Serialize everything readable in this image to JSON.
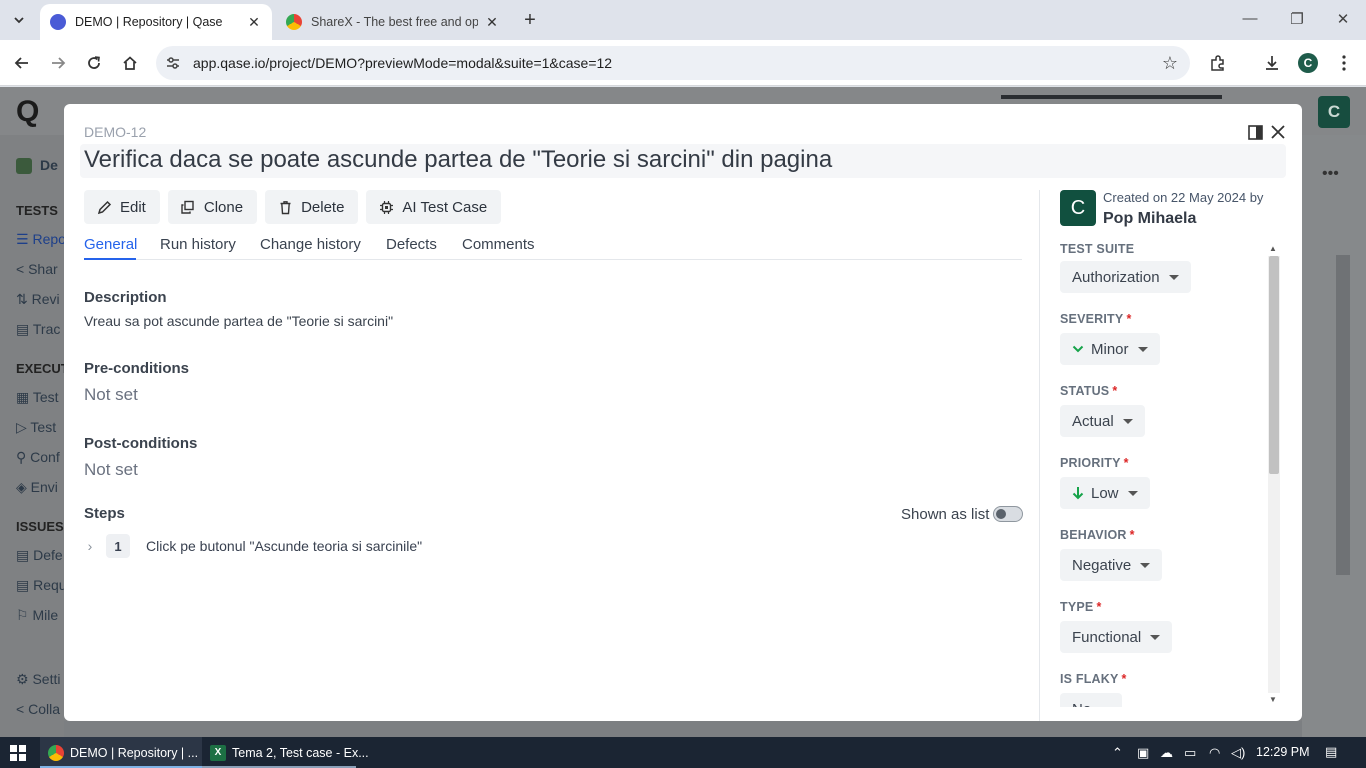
{
  "browser": {
    "tabs": [
      {
        "title": "DEMO | Repository | Qase",
        "active": true
      },
      {
        "title": "ShareX - The best free and ope",
        "active": false
      }
    ],
    "url": "app.qase.io/project/DEMO?previewMode=modal&suite=1&case=12",
    "profile_initial": "C"
  },
  "background_app": {
    "logo": "Q",
    "avatar_initial": "C",
    "sidebar": [
      {
        "text": "De",
        "kind": "project"
      },
      {
        "text": "TESTS",
        "kind": "heading"
      },
      {
        "text": "Repo",
        "kind": "item"
      },
      {
        "text": "Shar",
        "kind": "item"
      },
      {
        "text": "Revi",
        "kind": "item"
      },
      {
        "text": "Trac",
        "kind": "item"
      },
      {
        "text": "EXECUTI",
        "kind": "heading"
      },
      {
        "text": "Test",
        "kind": "item"
      },
      {
        "text": "Test",
        "kind": "item"
      },
      {
        "text": "Conf",
        "kind": "item"
      },
      {
        "text": "Envi",
        "kind": "item"
      },
      {
        "text": "ISSUES",
        "kind": "heading"
      },
      {
        "text": "Defe",
        "kind": "item"
      },
      {
        "text": "Requ",
        "kind": "item"
      },
      {
        "text": "Mile",
        "kind": "item"
      },
      {
        "text": "Setti",
        "kind": "item"
      },
      {
        "text": "Colla",
        "kind": "item"
      }
    ]
  },
  "modal": {
    "case_id": "DEMO-12",
    "title": "Verifica daca se poate ascunde partea de \"Teorie si sarcini\" din pagina",
    "actions": [
      {
        "label": "Edit",
        "icon": "pencil-icon"
      },
      {
        "label": "Clone",
        "icon": "copy-icon"
      },
      {
        "label": "Delete",
        "icon": "trash-icon"
      },
      {
        "label": "AI Test Case",
        "icon": "chip-icon"
      }
    ],
    "tabs": [
      "General",
      "Run history",
      "Change history",
      "Defects",
      "Comments"
    ],
    "active_tab": "General",
    "description_label": "Description",
    "description": "Vreau sa pot ascunde partea de \"Teorie si sarcini\"",
    "preconditions_label": "Pre-conditions",
    "preconditions": "Not set",
    "postconditions_label": "Post-conditions",
    "postconditions": "Not set",
    "steps_label": "Steps",
    "shown_as_list_label": "Shown as list",
    "shown_as_list": false,
    "steps": [
      {
        "number": "1",
        "text": "Click pe butonul \"Ascunde teoria si sarcinile\""
      }
    ]
  },
  "sidepanel": {
    "avatar_initial": "C",
    "created_on": "Created on 22 May 2024 by",
    "author": "Pop Mihaela",
    "properties": [
      {
        "label": "TEST SUITE",
        "required": false,
        "value": "Authorization",
        "icon": null
      },
      {
        "label": "SEVERITY",
        "required": true,
        "value": "Minor",
        "icon": "chevron-down-green-icon"
      },
      {
        "label": "STATUS",
        "required": true,
        "value": "Actual",
        "icon": null
      },
      {
        "label": "PRIORITY",
        "required": true,
        "value": "Low",
        "icon": "arrow-down-green-icon"
      },
      {
        "label": "BEHAVIOR",
        "required": true,
        "value": "Negative",
        "icon": null
      },
      {
        "label": "TYPE",
        "required": true,
        "value": "Functional",
        "icon": null
      },
      {
        "label": "IS FLAKY",
        "required": true,
        "value": "No",
        "icon": null
      }
    ],
    "required_marker": "*"
  },
  "taskbar": {
    "items": [
      {
        "label": "DEMO | Repository | ...",
        "icon": "chrome-icon",
        "active": true
      },
      {
        "label": "Tema 2, Test case - Ex...",
        "icon": "excel-icon",
        "active": false
      }
    ],
    "time": "12:29 PM"
  },
  "colors": {
    "accent": "#2563eb",
    "avatar": "#11503f",
    "required": "#dc2626",
    "green": "#16a34a"
  }
}
